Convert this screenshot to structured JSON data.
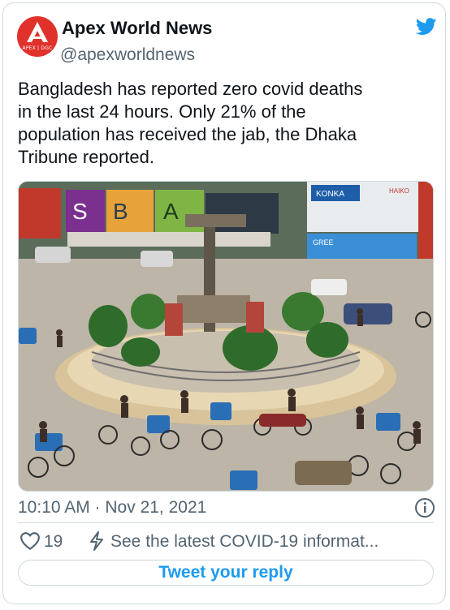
{
  "tweet": {
    "author_name": "Apex World News",
    "author_handle": "@apexworldnews",
    "avatar_text": "APEX | DGC",
    "text_lines": [
      "Bangladesh has reported zero covid deaths",
      "in the last 24 hours. Only 21% of the",
      "population has received the jab, the Dhaka",
      "Tribune reported."
    ],
    "timestamp": "10:10 AM · Nov 21, 2021",
    "like_count": "19",
    "covid_link": "See the latest COVID-19 informat...",
    "reply_label": "Tweet your reply"
  },
  "photo": {
    "billboards": [
      "S",
      "B",
      "A",
      "KONKA",
      "HAIKO",
      "GREE"
    ]
  },
  "colors": {
    "accent": "#1d9bf0",
    "secondary_text": "#536471",
    "border": "#cfd9de",
    "avatar_red": "#e0312b"
  },
  "icons": [
    "apex-logo-icon",
    "twitter-bird-icon",
    "info-icon",
    "heart-icon",
    "covid-info-icon"
  ]
}
